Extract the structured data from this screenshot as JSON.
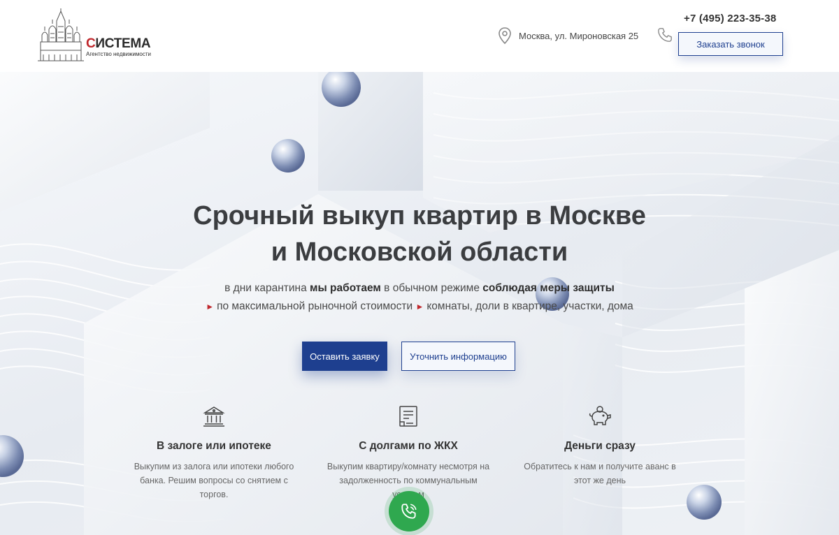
{
  "header": {
    "logo": {
      "name_first": "С",
      "name_rest": "ИСТЕМА",
      "tagline": "Агентство недвижимости"
    },
    "address": "Москва, ул. Мироновская 25",
    "phone": "+7 (495) 223-35-38",
    "callback_label": "Заказать звонок"
  },
  "hero": {
    "title_line1": "Срочный выкуп квартир в Москве",
    "title_line2": "и Московской области",
    "subtitle": {
      "p1": "в дни карантина ",
      "b1": "мы работаем",
      "p2": " в обычном режиме ",
      "b2": "соблюдая меры защиты",
      "item1": "по максимальной рыночной стоимости",
      "item2": "комнаты, доли в квартире, участки, дома"
    },
    "primary_button": "Оставить заявку",
    "secondary_button": "Уточнить информацию"
  },
  "features": [
    {
      "icon": "bank-icon",
      "title": "В залоге или ипотеке",
      "text": "Выкупим из залога или ипотеки любого банка. Решим вопросы со снятием с торгов."
    },
    {
      "icon": "document-icon",
      "title": "С долгами по ЖКХ",
      "text": "Выкупим квартиру/комнату несмотря на задолженность по коммунальным услугам"
    },
    {
      "icon": "piggy-bank-icon",
      "title": "Деньги сразу",
      "text": "Обратитесь к нам и получите аванс в этот же день"
    }
  ],
  "colors": {
    "accent": "#1e3f8f",
    "logo_red": "#c0282d",
    "call_button": "#2fa84f"
  }
}
